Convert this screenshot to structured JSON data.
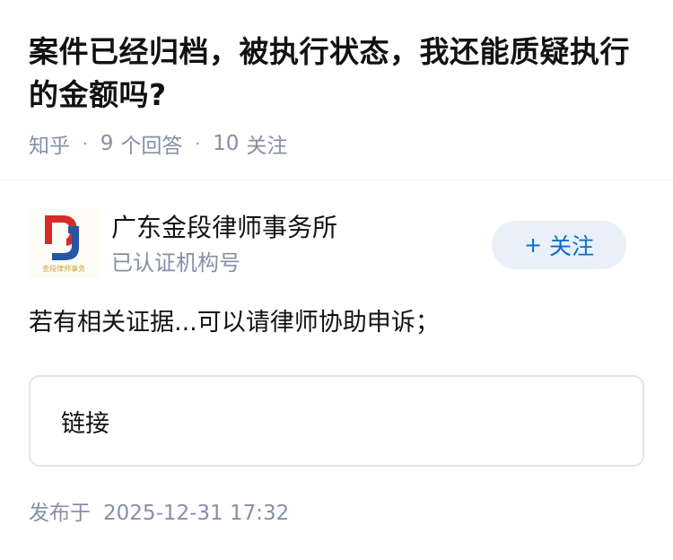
{
  "question": {
    "title": "案件已经归档，被执行状态，我还能质疑执行的金额吗?",
    "site": "知乎",
    "answers_count": "9",
    "answers_label": "个回答",
    "followers_count": "10",
    "followers_label": "关注",
    "separator": "·"
  },
  "author": {
    "name": "广东金段律师事务所",
    "tag": "已认证机构号",
    "follow_plus": "+",
    "follow_label": "关注",
    "logo_caption": "金段律师事务",
    "brand_colors": {
      "red": "#d92a2a",
      "blue": "#2456a6",
      "gold": "#c8a23a"
    }
  },
  "answer": {
    "content": "若有相关证据...可以请律师协助申诉；",
    "link_card_label": "链接",
    "publish_label": "发布于",
    "publish_time": "2025-12-31 17:32"
  },
  "colors": {
    "title": "#121212",
    "meta": "#8590a6",
    "follow_bg": "#e9f0fa",
    "follow_text": "#0b6ec9",
    "card_border": "#e3e5e8"
  }
}
